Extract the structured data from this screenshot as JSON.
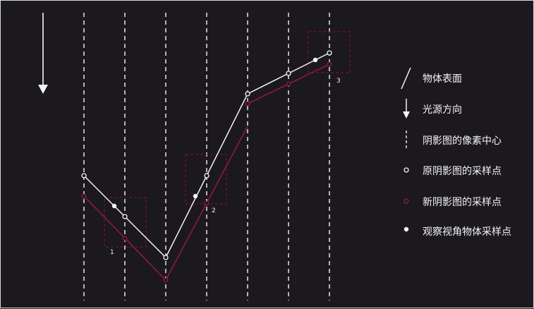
{
  "colors": {
    "background": "#1b181e",
    "surface_line": "#f4f4f4",
    "new_shadow_line": "#8c1a3c",
    "new_sample_ring": "#8c1a3c",
    "box_border": "#7a1228",
    "dashed_column": "#e8e8e8",
    "text": "#f4f4f4"
  },
  "light_arrow_icon": "arrow-down-icon",
  "boxes": [
    {
      "label": "1"
    },
    {
      "label": "2"
    },
    {
      "label": "3"
    }
  ],
  "legend": {
    "surface": "物体表面",
    "light": "光源方向",
    "pixel_center": "阴影图的像素中心",
    "old_sample": "原阴影图的采样点",
    "new_sample": "新阴影图的采样点",
    "view_sample": "观察视角物体采样点"
  }
}
